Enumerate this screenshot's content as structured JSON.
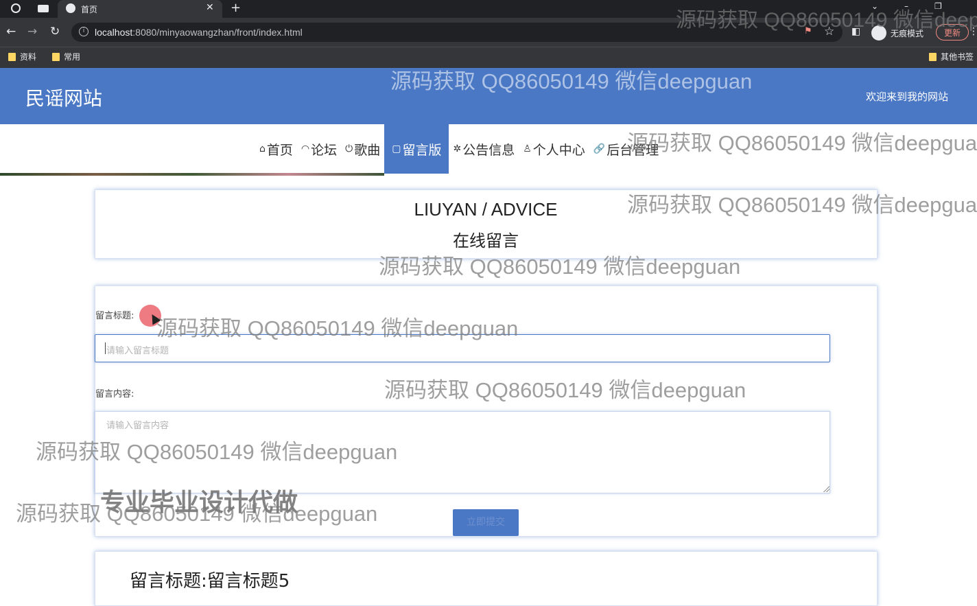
{
  "browser": {
    "tab_title": "首页",
    "tab_close": "✕",
    "new_tab": "+",
    "url_host": "localhost",
    "url_path": ":8080/minyaowangzhan/front/index.html",
    "incognito_label": "无痕模式",
    "update_label": "更新",
    "bookmarks": [
      "资料",
      "常用"
    ],
    "other_bookmarks": "其他书签",
    "nav_back": "←",
    "nav_forward": "→",
    "nav_reload": "↻",
    "star": "☆",
    "menu": "⋮"
  },
  "site": {
    "logo": "民谣网站",
    "welcome": "欢迎来到我的网站",
    "nav": [
      {
        "icon": "⌂",
        "label": "首页"
      },
      {
        "icon": "◠",
        "label": "论坛"
      },
      {
        "icon": "⏻",
        "label": "歌曲"
      },
      {
        "icon": "▢",
        "label": "留言版"
      },
      {
        "icon": "✲",
        "label": "公告信息"
      },
      {
        "icon": "♙",
        "label": "个人中心"
      },
      {
        "icon": "🔗",
        "label": "后台管理"
      }
    ],
    "active_nav": "留言版"
  },
  "section": {
    "title_en": "LIUYAN / ADVICE",
    "title_cn": "在线留言"
  },
  "form": {
    "title_label": "留言标题:",
    "title_placeholder": "请输入留言标题",
    "content_label": "留言内容:",
    "content_placeholder": "请输入留言内容",
    "submit_label": "立即提交"
  },
  "messages": [
    {
      "title_prefix": "留言标题:",
      "title": "留言标题5"
    }
  ],
  "watermark": {
    "text": "源码获取 QQ86050149 微信deepguan",
    "bold_text": "专业毕业设计代做"
  }
}
